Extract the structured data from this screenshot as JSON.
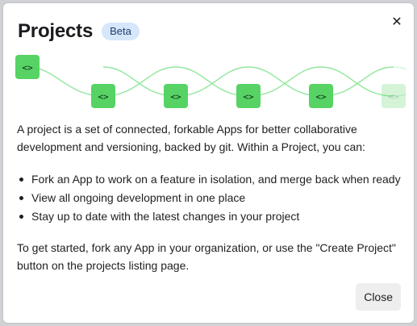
{
  "modal": {
    "title": "Projects",
    "badge": "Beta",
    "close_icon": "close-icon",
    "intro": "A project is a set of connected, forkable Apps for better collaborative development and versioning, backed by git. Within a Project, you can:",
    "bullets": [
      "Fork an App to work on a feature in isolation, and merge back when ready",
      "View all ongoing development in one place",
      "Stay up to date with the latest changes in your project"
    ],
    "outro": "To get started, fork any App in your organization, or use the \"Create Project\" button on the projects listing page.",
    "close_button": "Close"
  },
  "illustration": {
    "main_node_icon": "code-icon",
    "fork_node_icon": "code-icon",
    "fork_count": 5,
    "accent": "#56d364",
    "line_color": "#7be08b"
  }
}
